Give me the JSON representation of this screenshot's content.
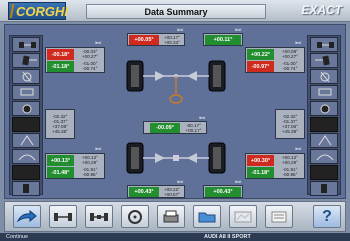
{
  "header": {
    "logo_text": "CORGHI",
    "title": "Data Summary",
    "brand": "EXACT"
  },
  "front_left": {
    "toe": "-00.18°",
    "camber": "-01.18°",
    "spec": [
      "-00.03°",
      "+00.27°",
      "-01.00°",
      "-00.74°"
    ],
    "tag": "limit"
  },
  "front_right": {
    "toe": "+00.22°",
    "camber": "-00.97°",
    "spec": [
      "+00.08°",
      "+00.27°",
      "-01.00°",
      "-00.74°"
    ],
    "tag": "limit"
  },
  "front_center": {
    "value": "+00.05°",
    "spec": [
      "+00.17°",
      "+00.33°"
    ],
    "tag": "limit"
  },
  "front_total": {
    "value": "+00.11°",
    "tag": "limit"
  },
  "mid_values_left": [
    "-02.32°",
    "-01.37°",
    "+37.06°",
    "+45.38°"
  ],
  "mid_values_right": [
    "-02.32°",
    "-01.37°",
    "+37.06°",
    "+45.38°"
  ],
  "thrust": {
    "value": "-00.09°",
    "spec": [
      "-00.17°",
      "+00.17°"
    ],
    "tag": "limit"
  },
  "rear_left": {
    "toe": "+00.13°",
    "camber": "-01.48°",
    "spec": [
      "+00.12°",
      "+00.29°",
      "-01.91°",
      "-00.95°"
    ],
    "tag": "limit"
  },
  "rear_right": {
    "toe": "+00.30°",
    "camber": "-01.18°",
    "spec": [
      "+00.12°",
      "+00.29°",
      "-01.91°",
      "-00.95°"
    ],
    "tag": "limit"
  },
  "rear_center": {
    "value": "+00.43°",
    "spec": [
      "+00.22°",
      "+00.57°"
    ],
    "tag": "limit"
  },
  "rear_total": {
    "value": "+00.43°",
    "tag": "limit"
  },
  "colors": {
    "out_of_range": "#cf2a1d",
    "in_range": "#238e2f",
    "panel": "#5f7099"
  },
  "toolbar": {
    "icons": [
      "arrow-right-icon",
      "axle-front-icon",
      "axle-rear-icon",
      "steering-wheel-icon",
      "printer-icon",
      "folder-icon",
      "map-icon",
      "document-icon",
      "help-icon"
    ],
    "help_label": "?"
  },
  "status": {
    "left": "Continue",
    "right": "AUDI A8 II SPORT"
  }
}
